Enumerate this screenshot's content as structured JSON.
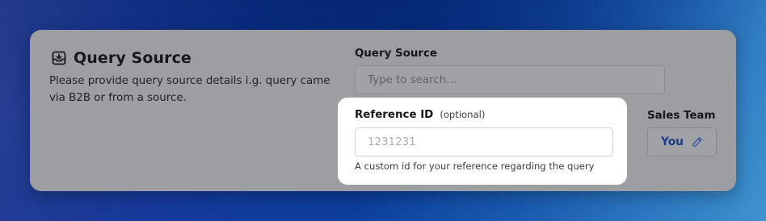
{
  "section": {
    "title": "Query Source",
    "description": "Please provide query source details i.g. query came via B2B or from a source."
  },
  "query_source": {
    "label": "Query Source",
    "placeholder": "Type to search..."
  },
  "sales_team": {
    "label": "Sales Team",
    "value": "You"
  },
  "reference": {
    "label": "Reference ID",
    "optional": "(optional)",
    "placeholder": "1231231",
    "help": "A custom id for your reference regarding the query"
  },
  "icons": {
    "title": "inbox-download-icon",
    "edit": "pencil-icon"
  },
  "colors": {
    "accent": "#1b3a8e",
    "card_overlay": "#9c9ea2",
    "focus_card": "#ffffff"
  }
}
